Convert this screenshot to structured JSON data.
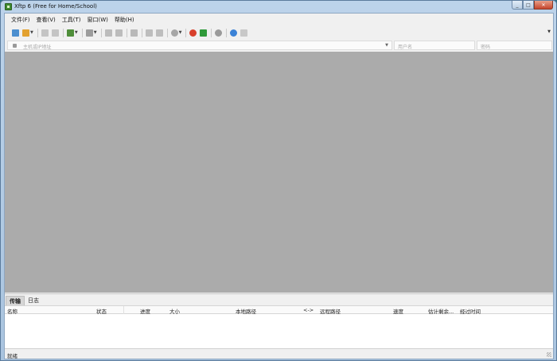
{
  "window": {
    "title": "Xftp 6 (Free for Home/School)"
  },
  "menu": [
    "文件(F)",
    "查看(V)",
    "工具(T)",
    "窗口(W)",
    "帮助(H)"
  ],
  "toolbar": {
    "icons": [
      {
        "name": "new-session-icon",
        "color": "#4d8fcf"
      },
      {
        "name": "open-folder-icon",
        "color": "#e3a12f"
      },
      {
        "name": "disconnect-icon",
        "color": "#c4c4c4"
      },
      {
        "name": "reconnect-icon",
        "color": "#c4c4c4"
      },
      {
        "name": "new-window-icon",
        "color": "#4f8e3a"
      },
      {
        "name": "layout-icon",
        "color": "#9c9c9c"
      },
      {
        "name": "copy-icon",
        "color": "#bcbcbc"
      },
      {
        "name": "paste-icon",
        "color": "#bcbcbc"
      },
      {
        "name": "transfer-icon",
        "color": "#b9b9b9"
      },
      {
        "name": "refresh-icon",
        "color": "#bdbdbd"
      },
      {
        "name": "properties-icon",
        "color": "#bdbdbd"
      },
      {
        "name": "encoding-icon",
        "color": "#a6a6a6"
      },
      {
        "name": "xshell-icon",
        "color": "#d8402c"
      },
      {
        "name": "xftp-icon",
        "color": "#2f9a3a"
      },
      {
        "name": "options-icon",
        "color": "#9a9a9a"
      },
      {
        "name": "help-icon",
        "color": "#3b82d6"
      },
      {
        "name": "chat-icon",
        "color": "#c8c8c8"
      }
    ]
  },
  "addressbar": {
    "host_placeholder": "主机或IP地址",
    "user_placeholder": "用户名",
    "password_placeholder": "密码"
  },
  "bottom_panel": {
    "tabs": [
      "传输",
      "日志"
    ],
    "columns": [
      "名称",
      "状态",
      "进度",
      "大小",
      "本地路径",
      "<->",
      "远程路径",
      "速度",
      "估计剩余...",
      "经过时间"
    ]
  },
  "statusbar": {
    "text": "就绪"
  }
}
